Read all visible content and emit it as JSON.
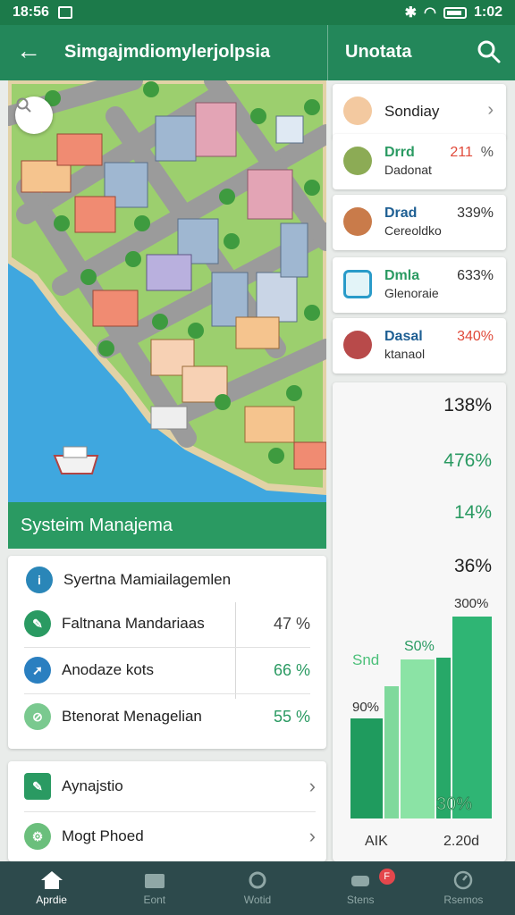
{
  "status_bar": {
    "time": "18:56",
    "right_time": "1:02"
  },
  "app_bar": {
    "title": "Simgajmdiomylerjolpsia",
    "secondary_title": "Unotata"
  },
  "map": {
    "caption": "Systeim Manajema"
  },
  "management": {
    "header": "Syertna Mamiailagemlen",
    "rows": [
      {
        "label": "Faltnana Mandariaas",
        "value": "47 %",
        "color": "#2a9a62"
      },
      {
        "label": "Anodaze kots",
        "value": "66 %",
        "color": "#2a7fc0"
      },
      {
        "label": "Btenorat Menagelian",
        "value": "55 %",
        "color": "#7ac98f"
      }
    ]
  },
  "nav_rows": [
    {
      "label": "Aynajstio"
    },
    {
      "label": "Mogt Phoed"
    }
  ],
  "side_cards": [
    {
      "title": "Sondiay",
      "subtitle": "",
      "value": ""
    },
    {
      "title": "Drrd",
      "subtitle": "Dadonat",
      "value": "211",
      "value_suffix": "%"
    },
    {
      "title": "Drad",
      "subtitle": "Cereoldko",
      "value": "339%"
    },
    {
      "title": "Dmla",
      "subtitle": "Glenoraie",
      "value": "633%"
    },
    {
      "title": "Dasal",
      "subtitle": "ktanaol",
      "value": "340%"
    }
  ],
  "stats": [
    "138%",
    "476%",
    "14%",
    "36%"
  ],
  "chart_data": {
    "type": "bar",
    "values": [],
    "labels": [
      "300%",
      "Snd",
      "S0%",
      "90%",
      "30%"
    ],
    "x_labels": [
      "AIK",
      "2.20d"
    ]
  },
  "bottom_nav": [
    {
      "label": "Aprdie"
    },
    {
      "label": "Eont"
    },
    {
      "label": "Wotid"
    },
    {
      "label": "Stens",
      "badge": "F"
    },
    {
      "label": "Rsemos"
    }
  ],
  "colors": {
    "primary": "#23875a",
    "accent": "#2a9a62",
    "nav_bg": "#2d4a4c"
  }
}
